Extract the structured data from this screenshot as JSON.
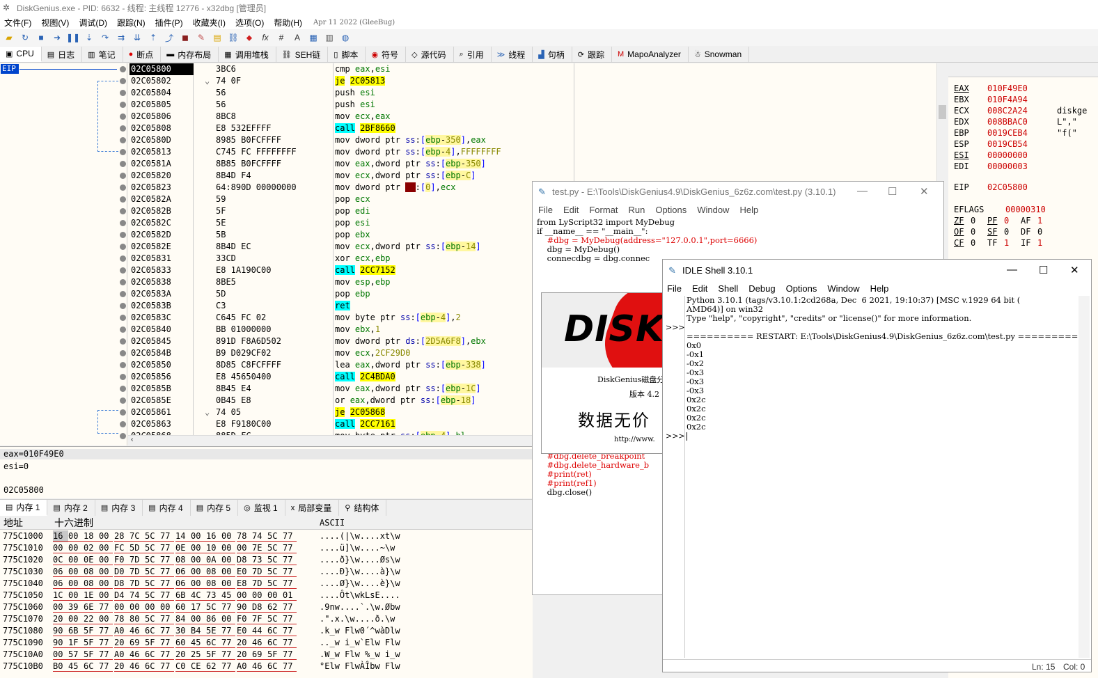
{
  "window": {
    "title": "DiskGenius.exe - PID: 6632 - 线程: 主线程 12776 - x32dbg [管理员]"
  },
  "menu": {
    "items": [
      "文件(F)",
      "视图(V)",
      "调试(D)",
      "跟踪(N)",
      "插件(P)",
      "收藏夹(I)",
      "选项(O)",
      "帮助(H)"
    ],
    "date": "Apr 11 2022 (GleeBug)"
  },
  "tabs": [
    {
      "label": "CPU",
      "icon": "cpu-icon"
    },
    {
      "label": "日志",
      "icon": "log-icon"
    },
    {
      "label": "笔记",
      "icon": "notes-icon"
    },
    {
      "label": "断点",
      "icon": "breakpoint-icon"
    },
    {
      "label": "内存布局",
      "icon": "memory-map-icon"
    },
    {
      "label": "调用堆栈",
      "icon": "call-stack-icon"
    },
    {
      "label": "SEH链",
      "icon": "seh-icon"
    },
    {
      "label": "脚本",
      "icon": "script-icon"
    },
    {
      "label": "符号",
      "icon": "symbols-icon"
    },
    {
      "label": "源代码",
      "icon": "source-icon"
    },
    {
      "label": "引用",
      "icon": "references-icon"
    },
    {
      "label": "线程",
      "icon": "threads-icon"
    },
    {
      "label": "句柄",
      "icon": "handles-icon"
    },
    {
      "label": "跟踪",
      "icon": "trace-icon"
    },
    {
      "label": "MapoAnalyzer",
      "icon": "mapo-icon"
    },
    {
      "label": "Snowman",
      "icon": "snowman-icon"
    }
  ],
  "disasm": {
    "eip_label": "EIP",
    "rows": [
      {
        "addr": "02C05800",
        "bytes": "3BC6",
        "instr": "cmp eax,esi",
        "current": true
      },
      {
        "addr": "02C05802",
        "bytes": "74 0F",
        "instr": "je 2C05813"
      },
      {
        "addr": "02C05804",
        "bytes": "56",
        "instr": "push esi"
      },
      {
        "addr": "02C05805",
        "bytes": "56",
        "instr": "push esi"
      },
      {
        "addr": "02C05806",
        "bytes": "8BC8",
        "instr": "mov ecx,eax"
      },
      {
        "addr": "02C05808",
        "bytes": "E8 532EFFFF",
        "instr": "call 2BF8660"
      },
      {
        "addr": "02C0580D",
        "bytes": "8985 B0FCFFFF",
        "instr": "mov dword ptr ss:[ebp-350],eax"
      },
      {
        "addr": "02C05813",
        "bytes": "C745 FC FFFFFFFF",
        "instr": "mov dword ptr ss:[ebp-4],FFFFFFFF"
      },
      {
        "addr": "02C0581A",
        "bytes": "8B85 B0FCFFFF",
        "instr": "mov eax,dword ptr ss:[ebp-350]"
      },
      {
        "addr": "02C05820",
        "bytes": "8B4D F4",
        "instr": "mov ecx,dword ptr ss:[ebp-C]"
      },
      {
        "addr": "02C05823",
        "bytes": "64:890D 00000000",
        "instr": "mov dword ptr fs:[0],ecx"
      },
      {
        "addr": "02C0582A",
        "bytes": "59",
        "instr": "pop ecx"
      },
      {
        "addr": "02C0582B",
        "bytes": "5F",
        "instr": "pop edi"
      },
      {
        "addr": "02C0582C",
        "bytes": "5E",
        "instr": "pop esi"
      },
      {
        "addr": "02C0582D",
        "bytes": "5B",
        "instr": "pop ebx"
      },
      {
        "addr": "02C0582E",
        "bytes": "8B4D EC",
        "instr": "mov ecx,dword ptr ss:[ebp-14]"
      },
      {
        "addr": "02C05831",
        "bytes": "33CD",
        "instr": "xor ecx,ebp"
      },
      {
        "addr": "02C05833",
        "bytes": "E8 1A190C00",
        "instr": "call 2CC7152"
      },
      {
        "addr": "02C05838",
        "bytes": "8BE5",
        "instr": "mov esp,ebp"
      },
      {
        "addr": "02C0583A",
        "bytes": "5D",
        "instr": "pop ebp"
      },
      {
        "addr": "02C0583B",
        "bytes": "C3",
        "instr": "ret"
      },
      {
        "addr": "02C0583C",
        "bytes": "C645 FC 02",
        "instr": "mov byte ptr ss:[ebp-4],2"
      },
      {
        "addr": "02C05840",
        "bytes": "BB 01000000",
        "instr": "mov ebx,1"
      },
      {
        "addr": "02C05845",
        "bytes": "891D F8A6D502",
        "instr": "mov dword ptr ds:[2D5A6F8],ebx"
      },
      {
        "addr": "02C0584B",
        "bytes": "B9 D029CF02",
        "instr": "mov ecx,2CF29D0"
      },
      {
        "addr": "02C05850",
        "bytes": "8D85 C8FCFFFF",
        "instr": "lea eax,dword ptr ss:[ebp-338]"
      },
      {
        "addr": "02C05856",
        "bytes": "E8 45650400",
        "instr": "call 2C4BDA0"
      },
      {
        "addr": "02C0585B",
        "bytes": "8B45 E4",
        "instr": "mov eax,dword ptr ss:[ebp-1C]"
      },
      {
        "addr": "02C0585E",
        "bytes": "0B45 E8",
        "instr": "or eax,dword ptr ss:[ebp-18]"
      },
      {
        "addr": "02C05861",
        "bytes": "74 05",
        "instr": "je 2C05868"
      },
      {
        "addr": "02C05863",
        "bytes": "E8 F9180C00",
        "instr": "call 2CC7161"
      },
      {
        "addr": "02C05868",
        "bytes": "885D FC",
        "instr": "mov byte ptr ss:[ebp-4],bl"
      }
    ]
  },
  "info": {
    "line1": "eax=010F49E0",
    "line2": "esi=0",
    "line3": "02C05800"
  },
  "memtabs": [
    {
      "label": "内存 1",
      "icon": "memory-icon"
    },
    {
      "label": "内存 2",
      "icon": "memory-icon"
    },
    {
      "label": "内存 3",
      "icon": "memory-icon"
    },
    {
      "label": "内存 4",
      "icon": "memory-icon"
    },
    {
      "label": "内存 5",
      "icon": "memory-icon"
    },
    {
      "label": "监视 1",
      "icon": "watch-icon"
    },
    {
      "label": "局部变量",
      "icon": "locals-icon"
    },
    {
      "label": "结构体",
      "icon": "struct-icon"
    }
  ],
  "dump": {
    "headers": {
      "addr": "地址",
      "hex": "十六进制",
      "ascii": "ASCII"
    },
    "rows": [
      {
        "addr": "775C1000",
        "hex": [
          "16",
          "00",
          "18",
          "00",
          "28",
          "7C",
          "5C",
          "77",
          "14",
          "00",
          "16",
          "00",
          "78",
          "74",
          "5C",
          "77"
        ],
        "ascii": "....(|\\w....xt\\w"
      },
      {
        "addr": "775C1010",
        "hex": [
          "00",
          "00",
          "02",
          "00",
          "FC",
          "5D",
          "5C",
          "77",
          "0E",
          "00",
          "10",
          "00",
          "00",
          "7E",
          "5C",
          "77"
        ],
        "ascii": "....ü]\\w....~\\w"
      },
      {
        "addr": "775C1020",
        "hex": [
          "0C",
          "00",
          "0E",
          "00",
          "F0",
          "7D",
          "5C",
          "77",
          "08",
          "00",
          "0A",
          "00",
          "D8",
          "73",
          "5C",
          "77"
        ],
        "ascii": "....ð}\\w....Øs\\w"
      },
      {
        "addr": "775C1030",
        "hex": [
          "06",
          "00",
          "08",
          "00",
          "D0",
          "7D",
          "5C",
          "77",
          "06",
          "00",
          "08",
          "00",
          "E0",
          "7D",
          "5C",
          "77"
        ],
        "ascii": "....Ð}\\w....à}\\w"
      },
      {
        "addr": "775C1040",
        "hex": [
          "06",
          "00",
          "08",
          "00",
          "D8",
          "7D",
          "5C",
          "77",
          "06",
          "00",
          "08",
          "00",
          "E8",
          "7D",
          "5C",
          "77"
        ],
        "ascii": "....Ø}\\w....è}\\w"
      },
      {
        "addr": "775C1050",
        "hex": [
          "1C",
          "00",
          "1E",
          "00",
          "D4",
          "74",
          "5C",
          "77",
          "6B",
          "4C",
          "73",
          "45",
          "00",
          "00",
          "00",
          "01"
        ],
        "ascii": "....Ôt\\wkLsE...."
      },
      {
        "addr": "775C1060",
        "hex": [
          "00",
          "39",
          "6E",
          "77",
          "00",
          "00",
          "00",
          "00",
          "60",
          "17",
          "5C",
          "77",
          "90",
          "D8",
          "62",
          "77"
        ],
        "ascii": ".9nw....`.\\w.Øbw"
      },
      {
        "addr": "775C1070",
        "hex": [
          "20",
          "00",
          "22",
          "00",
          "78",
          "80",
          "5C",
          "77",
          "84",
          "00",
          "86",
          "00",
          "F0",
          "7F",
          "5C",
          "77"
        ],
        "ascii": " .\".x.\\w....ð.\\w"
      },
      {
        "addr": "775C1080",
        "hex": [
          "90",
          "6B",
          "5F",
          "77",
          "A0",
          "46",
          "6C",
          "77",
          "30",
          "B4",
          "5E",
          "77",
          "E0",
          "44",
          "6C",
          "77"
        ],
        "ascii": ".k_w Flw0´^wàDlw"
      },
      {
        "addr": "775C1090",
        "hex": [
          "90",
          "1F",
          "5F",
          "77",
          "20",
          "69",
          "5F",
          "77",
          "60",
          "45",
          "6C",
          "77",
          "20",
          "46",
          "6C",
          "77"
        ],
        "ascii": ".._w i_w`Elw Flw"
      },
      {
        "addr": "775C10A0",
        "hex": [
          "00",
          "57",
          "5F",
          "77",
          "A0",
          "46",
          "6C",
          "77",
          "20",
          "25",
          "5F",
          "77",
          "20",
          "69",
          "5F",
          "77"
        ],
        "ascii": ".W_w Flw %_w i_w"
      },
      {
        "addr": "775C10B0",
        "hex": [
          "B0",
          "45",
          "6C",
          "77",
          "20",
          "46",
          "6C",
          "77",
          "C0",
          "CE",
          "62",
          "77",
          "A0",
          "46",
          "6C",
          "77"
        ],
        "ascii": "°Elw FlwÀÎbw Flw"
      }
    ]
  },
  "registers": {
    "rows": [
      {
        "name": "EAX",
        "value": "010F49E0",
        "extra": ""
      },
      {
        "name": "EBX",
        "value": "010F4A94",
        "extra": ""
      },
      {
        "name": "ECX",
        "value": "008C2A24",
        "extra": "diskge"
      },
      {
        "name": "EDX",
        "value": "008BBAC0",
        "extra": "L\",\""
      },
      {
        "name": "EBP",
        "value": "0019CEB4",
        "extra": "\"f(\""
      },
      {
        "name": "ESP",
        "value": "0019CB54",
        "extra": ""
      },
      {
        "name": "ESI",
        "value": "00000000",
        "extra": ""
      },
      {
        "name": "EDI",
        "value": "00000003",
        "extra": ""
      }
    ],
    "eip_name": "EIP",
    "eip_value": "02C05800",
    "eflags_name": "EFLAGS",
    "eflags_value": "00000310",
    "flags_line1": [
      [
        "ZF",
        "0"
      ],
      [
        "PF",
        "0"
      ],
      [
        "AF",
        "1"
      ]
    ],
    "flags_line2": [
      [
        "OF",
        "0"
      ],
      [
        "SF",
        "0"
      ],
      [
        "DF",
        "0"
      ]
    ],
    "flags_line3": [
      [
        "CF",
        "0"
      ],
      [
        "TF",
        "1"
      ],
      [
        "IF",
        "1"
      ]
    ]
  },
  "testpy": {
    "title": "test.py - E:\\Tools\\DiskGenius4.9\\DiskGenius_6z6z.com\\test.py (3.10.1)",
    "menu": [
      "File",
      "Edit",
      "Format",
      "Run",
      "Options",
      "Window",
      "Help"
    ],
    "lines_top": [
      "from LyScript32 import MyDebug",
      "",
      "if __name__ == \"__main__\":",
      "    #dbg = MyDebug(address=\"127.0.0.1\",port=6666)",
      "    dbg = MyDebug()",
      "    connecdbg = dbg.connec"
    ],
    "lines_bottom": [
      "    #dbg.delete_breakpoint",
      "    #dbg.delete_hardware_b",
      "    #print(ret)",
      "    #print(ref1)",
      "    dbg.close()"
    ]
  },
  "splash": {
    "logo": "DISK",
    "line1": "DiskGenius磁盘分",
    "line2": "版本 4.2",
    "line3": "数据无价",
    "line4": "http://www."
  },
  "idle": {
    "title": "IDLE Shell 3.10.1",
    "menu": [
      "File",
      "Edit",
      "Shell",
      "Debug",
      "Options",
      "Window",
      "Help"
    ],
    "prompt": ">>>",
    "lines": [
      "Python 3.10.1 (tags/v3.10.1:2cd268a, Dec  6 2021, 19:10:37) [MSC v.1929 64 bit (",
      "AMD64)] on win32",
      "Type \"help\", \"copyright\", \"credits\" or \"license()\" for more information.",
      "",
      "========== RESTART: E:\\Tools\\DiskGenius4.9\\DiskGenius_6z6z.com\\test.py =========",
      "0x0",
      "-0x1",
      "-0x2",
      "-0x3",
      "-0x3",
      "-0x3",
      "0x2c",
      "0x2c",
      "0x2c",
      "0x2c"
    ],
    "status_ln": "Ln: 15",
    "status_col": "Col: 0"
  }
}
